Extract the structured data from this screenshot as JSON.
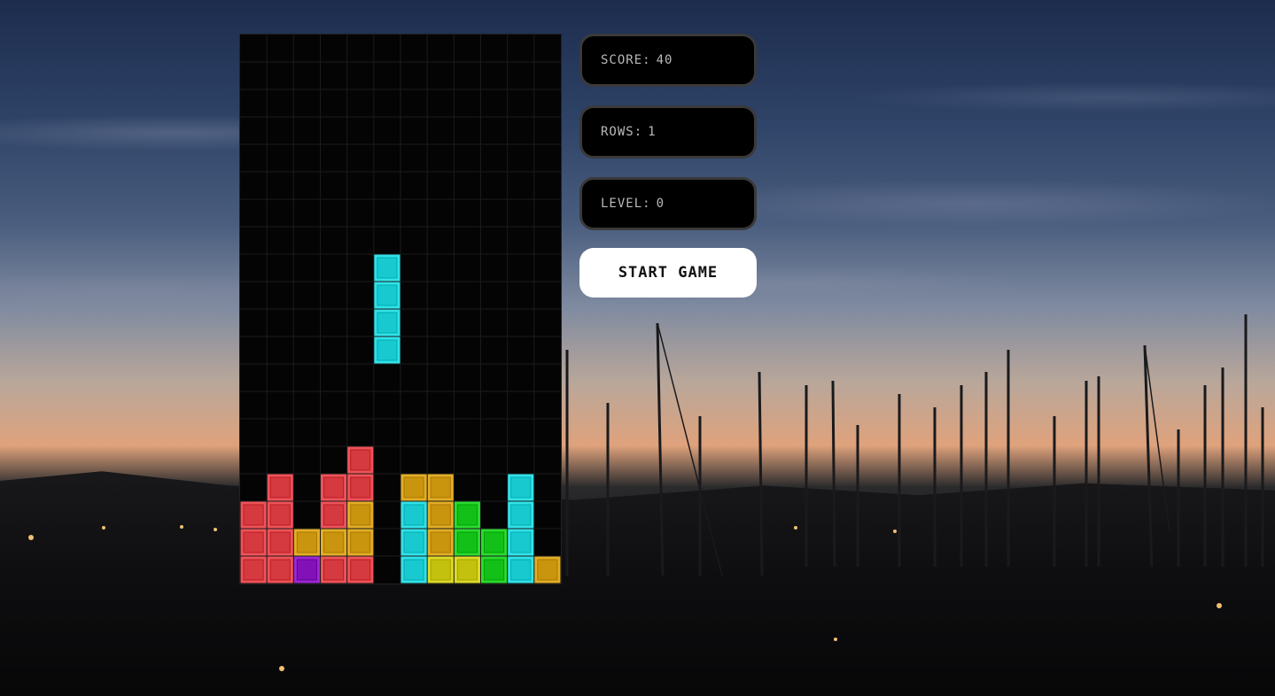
{
  "stats": {
    "score_label": "SCORE:",
    "score_value": "40",
    "rows_label": "ROWS:",
    "rows_value": "1",
    "level_label": "LEVEL:",
    "level_value": "0"
  },
  "controls": {
    "start_label": "START GAME"
  },
  "board": {
    "columns": 12,
    "rows": 20,
    "colors": {
      "red": "#d43a40",
      "cyan": "#18c9cf",
      "orange": "#c9950e",
      "green": "#12c018",
      "yellow": "#c4c10e",
      "purple": "#8211b8"
    },
    "cells": [
      {
        "row": 8,
        "col": 5,
        "color": "cyan"
      },
      {
        "row": 9,
        "col": 5,
        "color": "cyan"
      },
      {
        "row": 10,
        "col": 5,
        "color": "cyan"
      },
      {
        "row": 11,
        "col": 5,
        "color": "cyan"
      },
      {
        "row": 15,
        "col": 4,
        "color": "red"
      },
      {
        "row": 16,
        "col": 1,
        "color": "red"
      },
      {
        "row": 16,
        "col": 3,
        "color": "red"
      },
      {
        "row": 16,
        "col": 4,
        "color": "red"
      },
      {
        "row": 16,
        "col": 6,
        "color": "orange"
      },
      {
        "row": 16,
        "col": 7,
        "color": "orange"
      },
      {
        "row": 16,
        "col": 10,
        "color": "cyan"
      },
      {
        "row": 17,
        "col": 0,
        "color": "red"
      },
      {
        "row": 17,
        "col": 1,
        "color": "red"
      },
      {
        "row": 17,
        "col": 3,
        "color": "red"
      },
      {
        "row": 17,
        "col": 4,
        "color": "orange"
      },
      {
        "row": 17,
        "col": 6,
        "color": "cyan"
      },
      {
        "row": 17,
        "col": 7,
        "color": "orange"
      },
      {
        "row": 17,
        "col": 8,
        "color": "green"
      },
      {
        "row": 17,
        "col": 10,
        "color": "cyan"
      },
      {
        "row": 18,
        "col": 0,
        "color": "red"
      },
      {
        "row": 18,
        "col": 1,
        "color": "red"
      },
      {
        "row": 18,
        "col": 2,
        "color": "orange"
      },
      {
        "row": 18,
        "col": 3,
        "color": "orange"
      },
      {
        "row": 18,
        "col": 4,
        "color": "orange"
      },
      {
        "row": 18,
        "col": 6,
        "color": "cyan"
      },
      {
        "row": 18,
        "col": 7,
        "color": "orange"
      },
      {
        "row": 18,
        "col": 8,
        "color": "green"
      },
      {
        "row": 18,
        "col": 9,
        "color": "green"
      },
      {
        "row": 18,
        "col": 10,
        "color": "cyan"
      },
      {
        "row": 19,
        "col": 0,
        "color": "red"
      },
      {
        "row": 19,
        "col": 1,
        "color": "red"
      },
      {
        "row": 19,
        "col": 2,
        "color": "purple"
      },
      {
        "row": 19,
        "col": 3,
        "color": "red"
      },
      {
        "row": 19,
        "col": 4,
        "color": "red"
      },
      {
        "row": 19,
        "col": 6,
        "color": "cyan"
      },
      {
        "row": 19,
        "col": 7,
        "color": "yellow"
      },
      {
        "row": 19,
        "col": 8,
        "color": "yellow"
      },
      {
        "row": 19,
        "col": 9,
        "color": "green"
      },
      {
        "row": 19,
        "col": 10,
        "color": "cyan"
      },
      {
        "row": 19,
        "col": 11,
        "color": "orange"
      }
    ]
  }
}
